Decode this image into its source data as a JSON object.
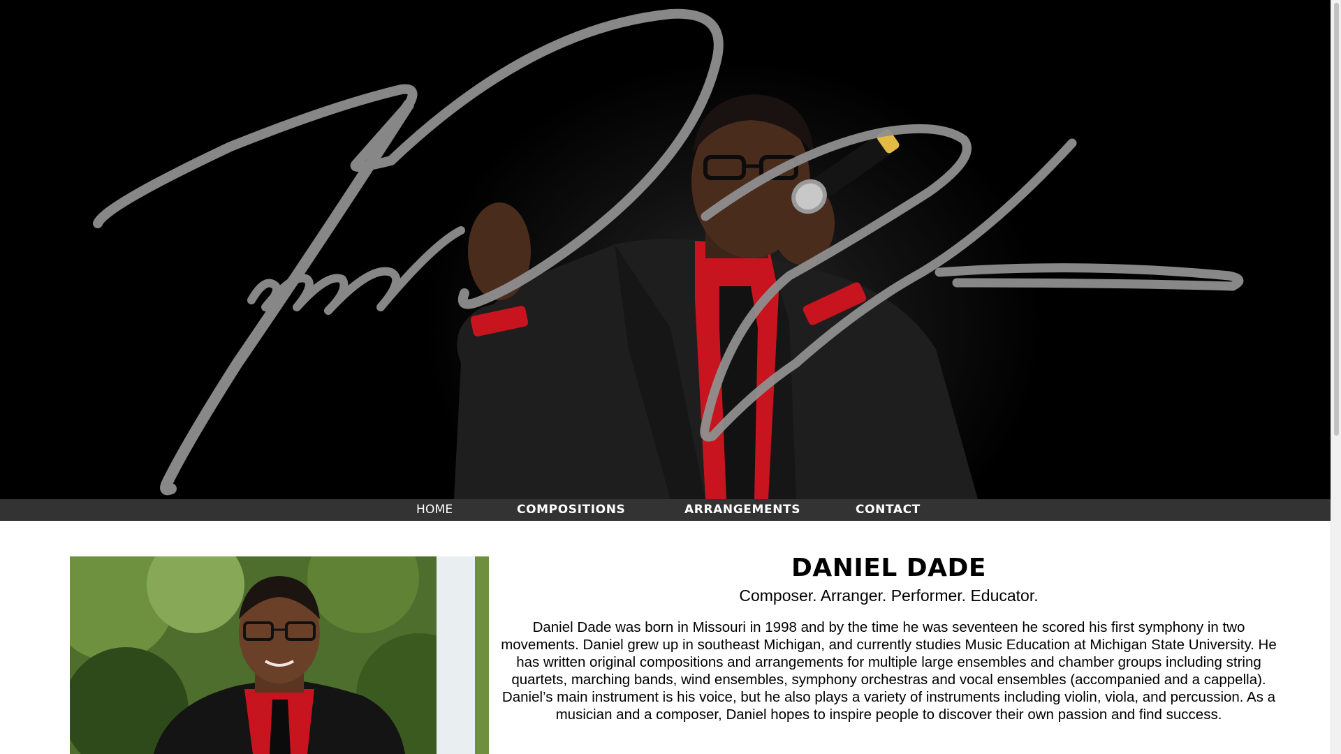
{
  "hero": {
    "signature": "Daniel Dade signature",
    "photo": "Daniel Dade singing into a microphone"
  },
  "nav": {
    "items": [
      {
        "label": "HOME",
        "active": true
      },
      {
        "label": "COMPOSITIONS",
        "active": false
      },
      {
        "label": "ARRANGEMENTS",
        "active": false
      },
      {
        "label": "CONTACT",
        "active": false
      }
    ]
  },
  "bio": {
    "name": "DANIEL DADE",
    "tagline": "Composer. Arranger. Performer. Educator.",
    "text": "Daniel Dade was born in Missouri in 1998 and by the time he was seventeen he scored his first symphony in two movements. Daniel grew up in southeast Michigan, and currently studies Music Education at Michigan State University. He has written original compositions and arrangements for multiple large ensembles and chamber groups including string quartets, marching bands, wind ensembles, symphony orchestras and vocal ensembles (accompanied and a cappella). Daniel’s main instrument is his voice, but he also plays a variety of instruments including violin, viola, and percussion. As a musician and a composer, Daniel hopes to inspire people to discover their own passion and find success."
  },
  "colors": {
    "hero_bg": "#000000",
    "nav_bg": "#333333",
    "signature": "#8f8f8f",
    "shirt_red": "#c8141e"
  }
}
